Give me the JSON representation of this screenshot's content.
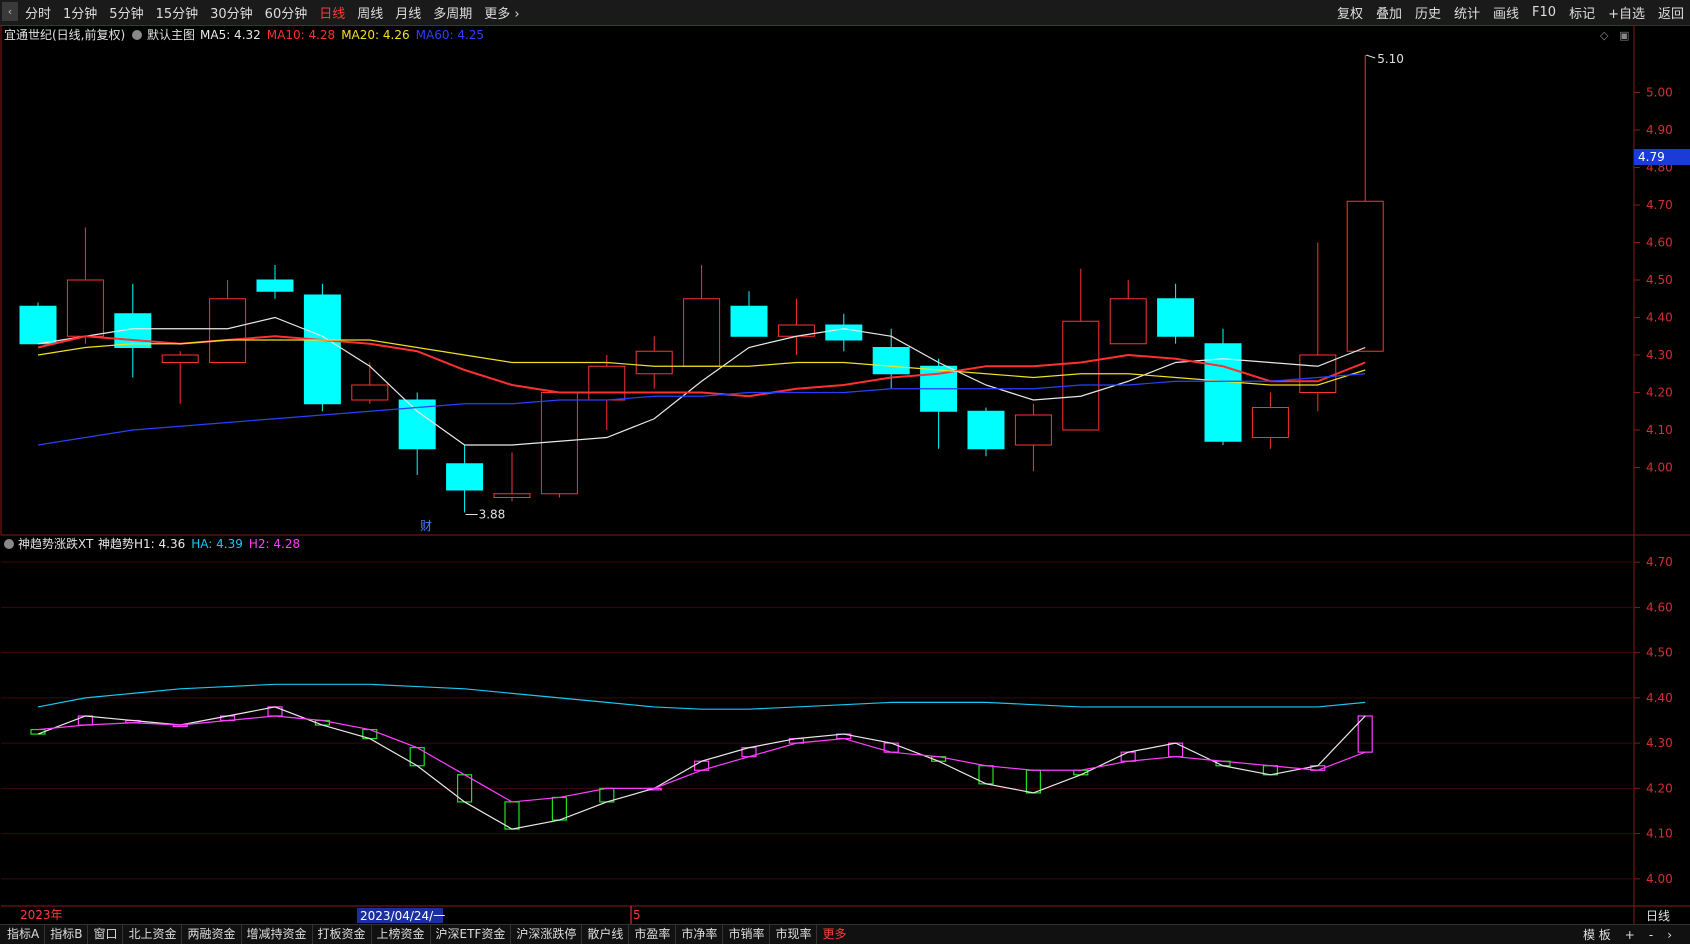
{
  "toolbar": {
    "arrow": "‹",
    "periods": [
      "分时",
      "1分钟",
      "5分钟",
      "15分钟",
      "30分钟",
      "60分钟",
      "日线",
      "周线",
      "月线",
      "多周期",
      "更多 ›"
    ],
    "active_period": "日线",
    "tools": [
      "复权",
      "叠加",
      "历史",
      "统计",
      "画线",
      "F10",
      "标记",
      "+自选",
      "返回"
    ]
  },
  "main_chart": {
    "stock": "宜通世纪(日线,前复权)",
    "template": "默认主图",
    "legend": [
      {
        "label": "MA5: 4.32",
        "color": "#e8e8e8"
      },
      {
        "label": "MA10: 4.28",
        "color": "#ff3030"
      },
      {
        "label": "MA20: 4.26",
        "color": "#f0e020"
      },
      {
        "label": "MA60: 4.25",
        "color": "#2a40ff"
      }
    ],
    "high_label": "5.10",
    "low_label": "3.88",
    "marker": "财",
    "current_price": "4.79"
  },
  "sub_chart": {
    "name": "神趋势涨跌XT",
    "legend": [
      {
        "label": "神趋势H1: 4.36",
        "color": "#e8e8e8"
      },
      {
        "label": "HA: 4.39",
        "color": "#19c8f0"
      },
      {
        "label": "H2: 4.28",
        "color": "#ff40ff"
      }
    ]
  },
  "time_axis": {
    "left_label": "2023年",
    "cursor_label": "2023/04/24/一",
    "mid_label": "5",
    "period_label": "日线"
  },
  "chart_data": [
    {
      "type": "candlestick",
      "title": "宜通世纪(日线,前复权)",
      "y_ticks": [
        4.0,
        4.1,
        4.2,
        4.3,
        4.4,
        4.5,
        4.6,
        4.7,
        4.8,
        4.9,
        5.0
      ],
      "ylim": [
        3.82,
        5.18
      ],
      "grid": false,
      "candles": [
        {
          "o": 4.43,
          "h": 4.44,
          "l": 4.33,
          "c": 4.33
        },
        {
          "o": 4.35,
          "h": 4.64,
          "l": 4.33,
          "c": 4.5
        },
        {
          "o": 4.41,
          "h": 4.49,
          "l": 4.24,
          "c": 4.32
        },
        {
          "o": 4.28,
          "h": 4.31,
          "l": 4.17,
          "c": 4.3
        },
        {
          "o": 4.28,
          "h": 4.5,
          "l": 4.28,
          "c": 4.45
        },
        {
          "o": 4.5,
          "h": 4.54,
          "l": 4.45,
          "c": 4.47
        },
        {
          "o": 4.46,
          "h": 4.49,
          "l": 4.15,
          "c": 4.17
        },
        {
          "o": 4.18,
          "h": 4.28,
          "l": 4.17,
          "c": 4.22
        },
        {
          "o": 4.18,
          "h": 4.2,
          "l": 3.98,
          "c": 4.05
        },
        {
          "o": 4.01,
          "h": 4.06,
          "l": 3.88,
          "c": 3.94
        },
        {
          "o": 3.92,
          "h": 4.04,
          "l": 3.91,
          "c": 3.93
        },
        {
          "o": 3.93,
          "h": 4.2,
          "l": 3.92,
          "c": 4.2
        },
        {
          "o": 4.18,
          "h": 4.3,
          "l": 4.1,
          "c": 4.27
        },
        {
          "o": 4.25,
          "h": 4.35,
          "l": 4.21,
          "c": 4.31
        },
        {
          "o": 4.27,
          "h": 4.54,
          "l": 4.27,
          "c": 4.45
        },
        {
          "o": 4.43,
          "h": 4.47,
          "l": 4.35,
          "c": 4.35
        },
        {
          "o": 4.35,
          "h": 4.45,
          "l": 4.3,
          "c": 4.38
        },
        {
          "o": 4.38,
          "h": 4.41,
          "l": 4.31,
          "c": 4.34
        },
        {
          "o": 4.32,
          "h": 4.37,
          "l": 4.21,
          "c": 4.25
        },
        {
          "o": 4.27,
          "h": 4.29,
          "l": 4.05,
          "c": 4.15
        },
        {
          "o": 4.15,
          "h": 4.16,
          "l": 4.03,
          "c": 4.05
        },
        {
          "o": 4.06,
          "h": 4.17,
          "l": 3.99,
          "c": 4.14
        },
        {
          "o": 4.1,
          "h": 4.53,
          "l": 4.1,
          "c": 4.39
        },
        {
          "o": 4.33,
          "h": 4.5,
          "l": 4.33,
          "c": 4.45
        },
        {
          "o": 4.45,
          "h": 4.49,
          "l": 4.33,
          "c": 4.35
        },
        {
          "o": 4.33,
          "h": 4.37,
          "l": 4.06,
          "c": 4.07
        },
        {
          "o": 4.08,
          "h": 4.2,
          "l": 4.05,
          "c": 4.16
        },
        {
          "o": 4.2,
          "h": 4.6,
          "l": 4.15,
          "c": 4.3
        },
        {
          "o": 4.31,
          "h": 5.1,
          "l": 4.31,
          "c": 4.71
        }
      ],
      "series": [
        {
          "name": "MA5",
          "values": [
            4.33,
            4.35,
            4.37,
            4.37,
            4.37,
            4.4,
            4.35,
            4.27,
            4.15,
            4.06,
            4.06,
            4.07,
            4.08,
            4.13,
            4.23,
            4.32,
            4.35,
            4.37,
            4.35,
            4.28,
            4.22,
            4.18,
            4.19,
            4.23,
            4.28,
            4.29,
            4.28,
            4.27,
            4.32
          ]
        },
        {
          "name": "MA10",
          "values": [
            4.32,
            4.35,
            4.34,
            4.33,
            4.34,
            4.35,
            4.34,
            4.33,
            4.31,
            4.26,
            4.22,
            4.2,
            4.2,
            4.2,
            4.2,
            4.19,
            4.21,
            4.22,
            4.24,
            4.25,
            4.27,
            4.27,
            4.28,
            4.3,
            4.29,
            4.27,
            4.23,
            4.23,
            4.28
          ]
        },
        {
          "name": "MA20",
          "values": [
            4.3,
            4.32,
            4.33,
            4.33,
            4.34,
            4.34,
            4.34,
            4.34,
            4.32,
            4.3,
            4.28,
            4.28,
            4.28,
            4.27,
            4.27,
            4.27,
            4.28,
            4.28,
            4.27,
            4.26,
            4.25,
            4.24,
            4.25,
            4.25,
            4.24,
            4.23,
            4.22,
            4.22,
            4.26
          ]
        },
        {
          "name": "MA60",
          "values": [
            4.06,
            4.08,
            4.1,
            4.11,
            4.12,
            4.13,
            4.14,
            4.15,
            4.16,
            4.17,
            4.17,
            4.18,
            4.18,
            4.19,
            4.19,
            4.2,
            4.2,
            4.2,
            4.21,
            4.21,
            4.21,
            4.21,
            4.22,
            4.22,
            4.23,
            4.23,
            4.23,
            4.24,
            4.25
          ]
        }
      ]
    },
    {
      "type": "line",
      "title": "神趋势涨跌XT",
      "y_ticks": [
        4.0,
        4.1,
        4.2,
        4.3,
        4.4,
        4.5,
        4.6,
        4.7
      ],
      "ylim": [
        3.94,
        4.76
      ],
      "grid": true,
      "series": [
        {
          "name": "神趋势H1",
          "values": [
            4.32,
            4.36,
            4.35,
            4.34,
            4.36,
            4.38,
            4.34,
            4.31,
            4.25,
            4.17,
            4.11,
            4.13,
            4.17,
            4.2,
            4.26,
            4.29,
            4.31,
            4.32,
            4.3,
            4.26,
            4.21,
            4.19,
            4.23,
            4.28,
            4.3,
            4.25,
            4.23,
            4.25,
            4.36
          ]
        },
        {
          "name": "HA",
          "values": [
            4.38,
            4.4,
            4.41,
            4.42,
            4.425,
            4.43,
            4.43,
            4.43,
            4.425,
            4.42,
            4.41,
            4.4,
            4.39,
            4.38,
            4.375,
            4.375,
            4.38,
            4.385,
            4.39,
            4.39,
            4.39,
            4.385,
            4.38,
            4.38,
            4.38,
            4.38,
            4.38,
            4.38,
            4.39
          ]
        },
        {
          "name": "H2",
          "values": [
            4.33,
            4.34,
            4.345,
            4.34,
            4.35,
            4.36,
            4.35,
            4.33,
            4.29,
            4.23,
            4.17,
            4.18,
            4.2,
            4.2,
            4.24,
            4.27,
            4.3,
            4.31,
            4.28,
            4.27,
            4.25,
            4.24,
            4.24,
            4.26,
            4.27,
            4.26,
            4.25,
            4.24,
            4.28
          ]
        }
      ]
    }
  ]
}
